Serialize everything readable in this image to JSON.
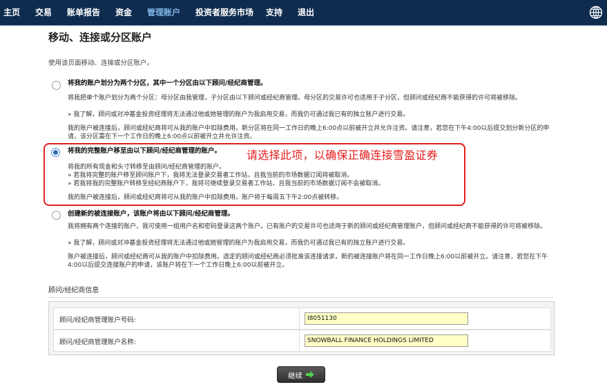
{
  "nav": {
    "items": [
      "主页",
      "交易",
      "账单报告",
      "资金",
      "管理账户",
      "投资者服务市场",
      "支持",
      "退出"
    ],
    "active_index": 4
  },
  "page": {
    "title": "移动、连接或分区账户",
    "intro": "使用该页面移动、连接或分区账户。"
  },
  "options": [
    {
      "selected": false,
      "title": "将我的账户划分为两个分区，其中一个分区由以下顾问/经纪商管理。",
      "desc": "将我把单个账户划分为两个分区：母分区由我管理，子分区由以下顾问或经纪商管理。母分区的交易许可也适用于子分区，但顾问或经纪商不能获得的许可将被移除。",
      "bullet": "» 我了解，顾问或对冲基金投资经理将无法通过他或她管理的账户为我启用交易，而我仍可通过我已有的独立账户进行交易。",
      "note": "我的账户被连接后，顾问或经纪商将可从我的账户中扣除费用。新分区将在同一工作日的晚上6:00点以前被开立并允许注资。请注意，若您在下午4:00以后提交划分新分区的申请，该分区需在下一个工作日的晚上6:00点以前被开立并允许注资。"
    },
    {
      "selected": true,
      "title": "将我的完整账户移至由以下顾问/经纪商管理的账户。",
      "desc": "将我的所有现金和头寸转移至由顾问/经纪商管理的账户。",
      "bullets": [
        "» 若我将完整的账户移至顾问账户下，我将无法登录交易者工作站，且我当前的市场数据订阅将被取消。",
        "» 若我将我的完整账户转移至经纪商账户下，我将可继续登录交易者工作站，且我当前的市场数据订阅不会被取消。"
      ],
      "note": "我的账户被连接后，顾问或经纪商将可从我的账户中扣除费用。账户将于每周五下午2:00点被转移。"
    },
    {
      "selected": false,
      "title": "创建新的被连接账户，该账户将由以下顾问/经纪商管理。",
      "desc": "我将拥有两个连接的账户，我可使用一组用户名和密码登录这两个账户。已有账户的交易许可也适用于新的顾问或经纪商管理账户，但顾问或经纪商不能获得的许可将被移除。",
      "bullet": "» 我了解，顾问或对冲基金投资经理将无法通过他或她管理的账户为我启用交易，而我仍可通过我已有的独立账户进行交易。",
      "note": "账户被连接后，顾问或经纪商可从我的账户中扣除费用。选定的顾问或经纪商必须批准该连接请求，新的被连接账户将在同一工作日晚上6:00以前被开立。请注意，若您在下午4:00以后提交连接账户的申请，该账户将在下一个工作日晚上6:00以前被开立。"
    }
  ],
  "annotation": "请选择此项，以确保正确连接雪盈证券",
  "advisor_info": {
    "heading": "顾问/经纪商信息",
    "account_number_label": "顾问/经纪商管理账户号码:",
    "account_number": "I8051130",
    "account_name_label": "顾问/经纪商管理账户名称:",
    "account_name": "SNOWBALL FINANCE HOLDINGS LIMITED"
  },
  "continue_label": "继续",
  "colors": {
    "nav_bg": "#0f2c4f",
    "nav_active": "#7fb6e6",
    "highlight": "#e51d1d",
    "input_bg": "#ffffc6"
  },
  "icons": {
    "globe": "globe-icon",
    "continue_arrow": "arrow-right-icon"
  }
}
